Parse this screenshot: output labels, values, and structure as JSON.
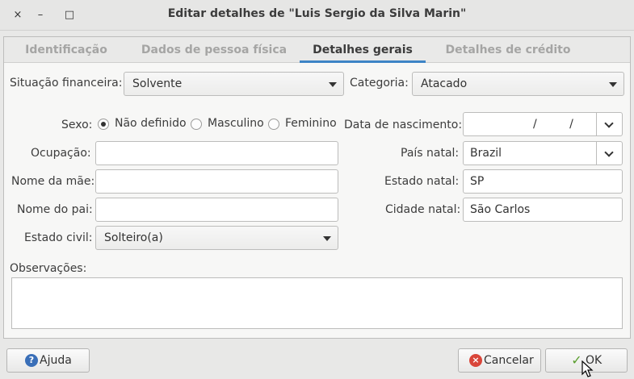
{
  "window": {
    "title": "Editar detalhes de \"Luis Sergio da Silva Marin\"",
    "close_glyph": "×",
    "minimize_glyph": "–",
    "maximize_glyph": "□"
  },
  "tabs": [
    {
      "label": "Identificação"
    },
    {
      "label": "Dados de pessoa física"
    },
    {
      "label": "Detalhes gerais"
    },
    {
      "label": "Detalhes de crédito"
    }
  ],
  "form": {
    "situacao_label": "Situação financeira:",
    "situacao_value": "Solvente",
    "categoria_label": "Categoria:",
    "categoria_value": "Atacado",
    "sexo_label": "Sexo:",
    "sexo_options": [
      "Não definido",
      "Masculino",
      "Feminino"
    ],
    "sexo_selected": "Não definido",
    "ocupacao_label": "Ocupação:",
    "ocupacao_value": "",
    "mae_label": "Nome da mãe:",
    "mae_value": "",
    "pai_label": "Nome do pai:",
    "pai_value": "",
    "estado_civil_label": "Estado civil:",
    "estado_civil_value": "Solteiro(a)",
    "nascimento_label": "Data de nascimento:",
    "nascimento_value": "/ /",
    "pais_label": "País natal:",
    "pais_value": "Brazil",
    "estado_label": "Estado natal:",
    "estado_value": "SP",
    "cidade_label": "Cidade natal:",
    "cidade_value": "São Carlos",
    "obs_label": "Observações:",
    "obs_value": ""
  },
  "buttons": {
    "help_label": "Ajuda",
    "help_icon": "?",
    "cancel_label": "Cancelar",
    "cancel_icon": "×",
    "ok_label": "OK",
    "ok_icon": "✓"
  },
  "colors": {
    "accent": "#3d84c6",
    "cancel_icon": "#d9463a",
    "help_icon": "#3a6fb8",
    "ok_icon": "#5a9e2f"
  }
}
